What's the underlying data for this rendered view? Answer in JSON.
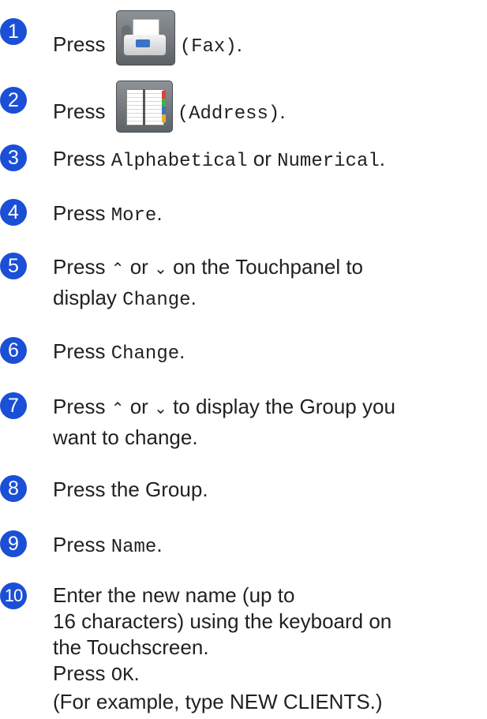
{
  "steps": [
    {
      "num": "1",
      "pre": "Press",
      "icon": "fax-icon",
      "code": "(Fax)",
      "post": "."
    },
    {
      "num": "2",
      "pre": "Press",
      "icon": "address-book-icon",
      "code": "(Address)",
      "post": "."
    },
    {
      "num": "3",
      "pre": "Press",
      "code1": "Alphabetical",
      "mid": "or",
      "code2": "Numerical",
      "post": "."
    },
    {
      "num": "4",
      "pre": "Press",
      "code": "More",
      "post": "."
    },
    {
      "num": "5",
      "pre": "Press",
      "up": "⌃",
      "or": "or",
      "down": "⌄",
      "line1_post": "on the Touchpanel to",
      "line2_pre": "display",
      "code": "Change",
      "post": "."
    },
    {
      "num": "6",
      "pre": "Press",
      "code": "Change",
      "post": "."
    },
    {
      "num": "7",
      "pre": "Press",
      "up": "⌃",
      "or": "or",
      "down": "⌄",
      "line1_post": "to display the Group you",
      "line2": "want to change."
    },
    {
      "num": "8",
      "text": "Press the Group."
    },
    {
      "num": "9",
      "pre": "Press",
      "code": "Name",
      "post": "."
    },
    {
      "num": "10",
      "line1": "Enter the new name (up to",
      "line2": "16 characters) using the keyboard on",
      "line3": "the Touchscreen.",
      "line4_pre": "Press",
      "line4_code": "OK",
      "line4_post": ".",
      "line5": "(For example, type NEW CLIENTS.)"
    }
  ]
}
